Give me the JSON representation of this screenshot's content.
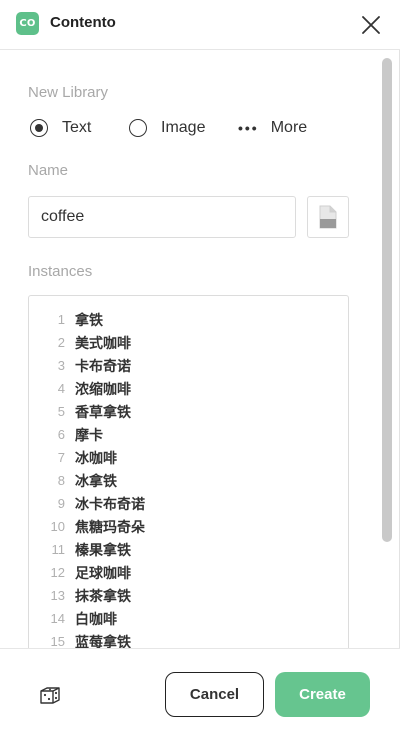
{
  "app": {
    "logo_text": "CO",
    "title": "Contento",
    "accent_color": "#5ec08a"
  },
  "new_library": {
    "label": "New Library",
    "options": [
      {
        "label": "Text",
        "selected": true,
        "icon": "radio-selected"
      },
      {
        "label": "Image",
        "selected": false,
        "icon": "radio-unselected"
      },
      {
        "label": "More",
        "selected": false,
        "icon": "more-dots-icon"
      }
    ]
  },
  "name": {
    "label": "Name",
    "value": "coffee",
    "file_icon": "document-icon"
  },
  "instances": {
    "label": "Instances",
    "items": [
      {
        "num": "1",
        "text": "拿铁"
      },
      {
        "num": "2",
        "text": "美式咖啡"
      },
      {
        "num": "3",
        "text": "卡布奇诺"
      },
      {
        "num": "4",
        "text": "浓缩咖啡"
      },
      {
        "num": "5",
        "text": "香草拿铁"
      },
      {
        "num": "6",
        "text": "摩卡"
      },
      {
        "num": "7",
        "text": "冰咖啡"
      },
      {
        "num": "8",
        "text": "冰拿铁"
      },
      {
        "num": "9",
        "text": "冰卡布奇诺"
      },
      {
        "num": "10",
        "text": "焦糖玛奇朵"
      },
      {
        "num": "11",
        "text": "榛果拿铁"
      },
      {
        "num": "12",
        "text": "足球咖啡"
      },
      {
        "num": "13",
        "text": "抹茶拿铁"
      },
      {
        "num": "14",
        "text": "白咖啡"
      },
      {
        "num": "15",
        "text": "蓝莓拿铁"
      }
    ]
  },
  "footer": {
    "dice_icon": "dice-icon",
    "cancel_label": "Cancel",
    "create_label": "Create",
    "create_color": "#66c58f"
  }
}
